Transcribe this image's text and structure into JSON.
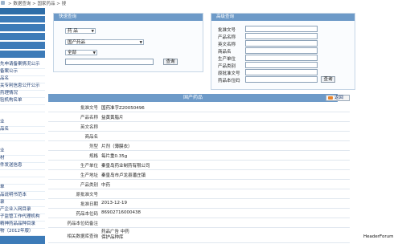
{
  "breadcrumb": {
    "text": "> 数据查询 > 国家药品 > 搜"
  },
  "sidebar": {
    "items": [
      {
        "label": "先申请备案情况公示"
      },
      {
        "label": "备案公示"
      },
      {
        "label": "品名"
      },
      {
        "label": "关专利信息公开公示"
      },
      {
        "label": "药理情况"
      },
      {
        "label": "验机构名单"
      },
      {
        "label": ""
      },
      {
        "label": "业"
      },
      {
        "label": "品名"
      },
      {
        "label": ""
      },
      {
        "label": "业"
      },
      {
        "label": "材"
      },
      {
        "label": "件发送信息"
      },
      {
        "label": ""
      },
      {
        "label": ""
      },
      {
        "label": "单"
      },
      {
        "label": "品说明书范本"
      },
      {
        "label": "录"
      },
      {
        "label": "产企业入网目录"
      },
      {
        "label": "子监管工作代理机构"
      },
      {
        "label": "精神药品品种目录"
      },
      {
        "label": "物（2012年版）"
      }
    ]
  },
  "quick_search": {
    "title": "快速查询",
    "select1": "药    品",
    "select2": "国产药品",
    "select3": "全部",
    "query_button": "查询"
  },
  "advanced_search": {
    "title": "高级查询",
    "fields": [
      "批准文号",
      "产品名称",
      "英文名称",
      "商品名",
      "生产单位",
      "产品类别",
      "原批准文号",
      "药品本位码"
    ],
    "query_button": "查询"
  },
  "detail": {
    "title": "国产药品",
    "back_button": "返回",
    "rows": [
      {
        "label": "批准文号",
        "value": "国药准字Z20050496"
      },
      {
        "label": "产品名称",
        "value": "益黄黄脂片"
      },
      {
        "label": "英文名称",
        "value": ""
      },
      {
        "label": "商品名",
        "value": ""
      },
      {
        "label": "剂型",
        "value": "片剂（薄膜衣）"
      },
      {
        "label": "规格",
        "value": "每片重0.35g"
      },
      {
        "label": "生产单位",
        "value": "秦皇岛药业制药有限公司"
      },
      {
        "label": "生产地址",
        "value": "秦皇岛市卢龙县潘庄镇"
      },
      {
        "label": "产品类别",
        "value": "中药"
      },
      {
        "label": "原批准文号",
        "value": ""
      },
      {
        "label": "批准日期",
        "value": "2013-12-19"
      },
      {
        "label": "药品本位码",
        "value": "86902716000438"
      },
      {
        "label": "药品本位码备注",
        "value": ""
      },
      {
        "label": "相关数据库查询",
        "value": "药品广告 中药保护品种库"
      }
    ]
  },
  "watermark": "HeaderForum"
}
